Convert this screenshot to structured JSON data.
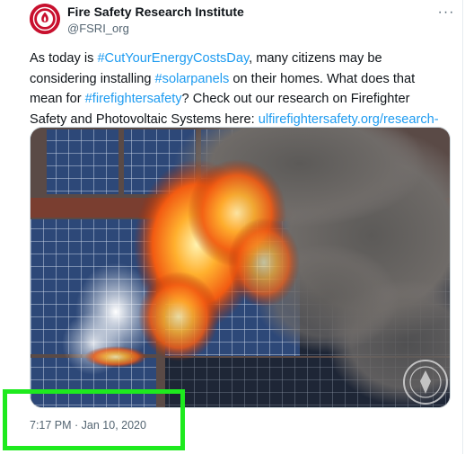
{
  "account": {
    "name": "Fire Safety Research Institute",
    "handle": "@FSRI_org",
    "avatar_icon": "fsri-seal-logo",
    "avatar_color": "#c8102e"
  },
  "more_icon": "more-options-icon",
  "more_label": "···",
  "tweet": {
    "segments": [
      {
        "text": "As today is ",
        "kind": "text"
      },
      {
        "text": "#CutYourEnergyCostsDay",
        "kind": "hashtag"
      },
      {
        "text": ", many citizens may be considering installing ",
        "kind": "text"
      },
      {
        "text": "#solarpanels",
        "kind": "hashtag"
      },
      {
        "text": " on their homes. What does that mean for ",
        "kind": "text"
      },
      {
        "text": "#firefightersafety",
        "kind": "hashtag"
      },
      {
        "text": "? Check out our research on Firefighter Safety and Photovoltaic Systems here: ",
        "kind": "text"
      },
      {
        "text": "ulfirefightersafety.org/research-proje…",
        "kind": "link"
      }
    ]
  },
  "media": {
    "description_icon": "photo-solar-panels-on-fire",
    "watermark_icon": "seal-watermark-icon"
  },
  "timestamp": "7:17 PM · Jan 10, 2020",
  "colors": {
    "link": "#1d9bf0",
    "secondary_text": "#536471",
    "highlight_box": "#1eea1e"
  }
}
